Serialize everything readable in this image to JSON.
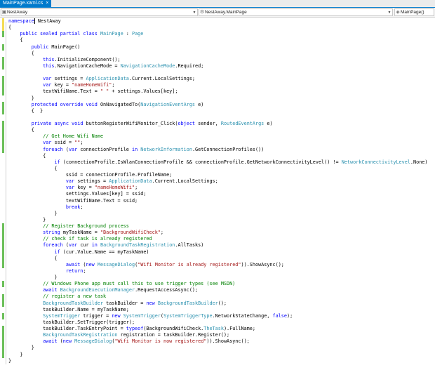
{
  "tab": {
    "label": "MainPage.xaml.cs",
    "close": "×"
  },
  "nav": {
    "project": "NestAway",
    "type": "NestAway.MainPage",
    "member": "MainPage()"
  },
  "code_lines": [
    [
      [
        "k",
        "namespace"
      ],
      [
        "p",
        " NestAway"
      ]
    ],
    [
      [
        "p",
        "{"
      ]
    ],
    [
      [
        "p",
        "    "
      ],
      [
        "k",
        "public sealed partial class"
      ],
      [
        "p",
        " "
      ],
      [
        "t",
        "MainPage"
      ],
      [
        "p",
        " : "
      ],
      [
        "t",
        "Page"
      ]
    ],
    [
      [
        "p",
        "    {"
      ]
    ],
    [
      [
        "p",
        "        "
      ],
      [
        "k",
        "public"
      ],
      [
        "p",
        " MainPage()"
      ]
    ],
    [
      [
        "p",
        "        {"
      ]
    ],
    [
      [
        "p",
        "            "
      ],
      [
        "k",
        "this"
      ],
      [
        "p",
        ".InitializeComponent();"
      ]
    ],
    [
      [
        "p",
        "            "
      ],
      [
        "k",
        "this"
      ],
      [
        "p",
        ".NavigationCacheMode = "
      ],
      [
        "t",
        "NavigationCacheMode"
      ],
      [
        "p",
        ".Required;"
      ]
    ],
    [
      [
        "p",
        ""
      ]
    ],
    [
      [
        "p",
        "            "
      ],
      [
        "k",
        "var"
      ],
      [
        "p",
        " settings = "
      ],
      [
        "t",
        "ApplicationData"
      ],
      [
        "p",
        ".Current.LocalSettings;"
      ]
    ],
    [
      [
        "p",
        "            "
      ],
      [
        "k",
        "var"
      ],
      [
        "p",
        " key = "
      ],
      [
        "s",
        "\"nameHomeWifi\""
      ],
      [
        "p",
        ";"
      ]
    ],
    [
      [
        "p",
        "            textWifiName.Text = "
      ],
      [
        "s",
        "\" \""
      ],
      [
        "p",
        " + settings.Values[key];"
      ]
    ],
    [
      [
        "p",
        "        }"
      ]
    ],
    [
      [
        "p",
        "        "
      ],
      [
        "k",
        "protected override void"
      ],
      [
        "p",
        " OnNavigatedTo("
      ],
      [
        "t",
        "NavigationEventArgs"
      ],
      [
        "p",
        " e)"
      ]
    ],
    [
      [
        "p",
        "        {  }"
      ]
    ],
    [
      [
        "p",
        ""
      ]
    ],
    [
      [
        "p",
        "        "
      ],
      [
        "k",
        "private async void"
      ],
      [
        "p",
        " buttonRegisterWifiMonitor_Click("
      ],
      [
        "k",
        "object"
      ],
      [
        "p",
        " sender, "
      ],
      [
        "t",
        "RoutedEventArgs"
      ],
      [
        "p",
        " e)"
      ]
    ],
    [
      [
        "p",
        "        {"
      ]
    ],
    [
      [
        "p",
        "            "
      ],
      [
        "c",
        "// Get Home Wifi Name"
      ]
    ],
    [
      [
        "p",
        "            "
      ],
      [
        "k",
        "var"
      ],
      [
        "p",
        " ssid = "
      ],
      [
        "s",
        "\"\""
      ],
      [
        "p",
        ";"
      ]
    ],
    [
      [
        "p",
        "            "
      ],
      [
        "k",
        "foreach"
      ],
      [
        "p",
        " ("
      ],
      [
        "k",
        "var"
      ],
      [
        "p",
        " connectionProfile "
      ],
      [
        "k",
        "in"
      ],
      [
        "p",
        " "
      ],
      [
        "t",
        "NetworkInformation"
      ],
      [
        "p",
        ".GetConnectionProfiles())"
      ]
    ],
    [
      [
        "p",
        "            {"
      ]
    ],
    [
      [
        "p",
        "                "
      ],
      [
        "k",
        "if"
      ],
      [
        "p",
        " (connectionProfile.IsWlanConnectionProfile && connectionProfile.GetNetworkConnectivityLevel() != "
      ],
      [
        "t",
        "NetworkConnectivityLevel"
      ],
      [
        "p",
        ".None)"
      ]
    ],
    [
      [
        "p",
        "                {"
      ]
    ],
    [
      [
        "p",
        "                    ssid = connectionProfile.ProfileName;"
      ]
    ],
    [
      [
        "p",
        "                    "
      ],
      [
        "k",
        "var"
      ],
      [
        "p",
        " settings = "
      ],
      [
        "t",
        "ApplicationData"
      ],
      [
        "p",
        ".Current.LocalSettings;"
      ]
    ],
    [
      [
        "p",
        "                    "
      ],
      [
        "k",
        "var"
      ],
      [
        "p",
        " key = "
      ],
      [
        "s",
        "\"nameHomeWifi\""
      ],
      [
        "p",
        ";"
      ]
    ],
    [
      [
        "p",
        "                    settings.Values[key] = ssid;"
      ]
    ],
    [
      [
        "p",
        "                    textWifiName.Text = ssid;"
      ]
    ],
    [
      [
        "p",
        "                    "
      ],
      [
        "k",
        "break"
      ],
      [
        "p",
        ";"
      ]
    ],
    [
      [
        "p",
        "                }"
      ]
    ],
    [
      [
        "p",
        "            }"
      ]
    ],
    [
      [
        "p",
        "            "
      ],
      [
        "c",
        "// Register Background process"
      ]
    ],
    [
      [
        "p",
        "            "
      ],
      [
        "k",
        "string"
      ],
      [
        "p",
        " myTaskName = "
      ],
      [
        "s",
        "\"BackgroundWifiCheck\""
      ],
      [
        "p",
        ";"
      ]
    ],
    [
      [
        "p",
        "            "
      ],
      [
        "c",
        "// check if task is already registered"
      ]
    ],
    [
      [
        "p",
        "            "
      ],
      [
        "k",
        "foreach"
      ],
      [
        "p",
        " ("
      ],
      [
        "k",
        "var"
      ],
      [
        "p",
        " cur "
      ],
      [
        "k",
        "in"
      ],
      [
        "p",
        " "
      ],
      [
        "t",
        "BackgroundTaskRegistration"
      ],
      [
        "p",
        ".AllTasks)"
      ]
    ],
    [
      [
        "p",
        "                "
      ],
      [
        "k",
        "if"
      ],
      [
        "p",
        " (cur.Value.Name == myTaskName)"
      ]
    ],
    [
      [
        "p",
        "                {"
      ]
    ],
    [
      [
        "p",
        "                    "
      ],
      [
        "k",
        "await"
      ],
      [
        "p",
        " ("
      ],
      [
        "k",
        "new"
      ],
      [
        "p",
        " "
      ],
      [
        "t",
        "MessageDialog"
      ],
      [
        "p",
        "("
      ],
      [
        "s",
        "\"Wifi Monitor is already registered\""
      ],
      [
        "p",
        ")).ShowAsync();"
      ]
    ],
    [
      [
        "p",
        "                    "
      ],
      [
        "k",
        "return"
      ],
      [
        "p",
        ";"
      ]
    ],
    [
      [
        "p",
        "                }"
      ]
    ],
    [
      [
        "p",
        "            "
      ],
      [
        "c",
        "// Windows Phone app must call this to use trigger types (see MSDN)"
      ]
    ],
    [
      [
        "p",
        "            "
      ],
      [
        "k",
        "await"
      ],
      [
        "p",
        " "
      ],
      [
        "t",
        "BackgroundExecutionManager"
      ],
      [
        "p",
        ".RequestAccessAsync();"
      ]
    ],
    [
      [
        "p",
        "            "
      ],
      [
        "c",
        "// register a new task"
      ]
    ],
    [
      [
        "p",
        "            "
      ],
      [
        "t",
        "BackgroundTaskBuilder"
      ],
      [
        "p",
        " taskBuilder = "
      ],
      [
        "k",
        "new"
      ],
      [
        "p",
        " "
      ],
      [
        "t",
        "BackgroundTaskBuilder"
      ],
      [
        "p",
        "();"
      ]
    ],
    [
      [
        "p",
        "            taskBuilder.Name = myTaskName;"
      ]
    ],
    [
      [
        "p",
        "            "
      ],
      [
        "t",
        "SystemTrigger"
      ],
      [
        "p",
        " trigger = "
      ],
      [
        "k",
        "new"
      ],
      [
        "p",
        " "
      ],
      [
        "t",
        "SystemTrigger"
      ],
      [
        "p",
        "("
      ],
      [
        "t",
        "SystemTriggerType"
      ],
      [
        "p",
        ".NetworkStateChange, "
      ],
      [
        "k",
        "false"
      ],
      [
        "p",
        ");"
      ]
    ],
    [
      [
        "p",
        "            taskBuilder.SetTrigger(trigger);"
      ]
    ],
    [
      [
        "p",
        "            taskBuilder.TaskEntryPoint = "
      ],
      [
        "k",
        "typeof"
      ],
      [
        "p",
        "(BackgroundWifiCheck."
      ],
      [
        "t",
        "TheTask"
      ],
      [
        "p",
        ").FullName;"
      ]
    ],
    [
      [
        "p",
        "            "
      ],
      [
        "t",
        "BackgroundTaskRegistration"
      ],
      [
        "p",
        " registration = taskBuilder.Register();"
      ]
    ],
    [
      [
        "p",
        "            "
      ],
      [
        "k",
        "await"
      ],
      [
        "p",
        " ("
      ],
      [
        "k",
        "new"
      ],
      [
        "p",
        " "
      ],
      [
        "t",
        "MessageDialog"
      ],
      [
        "p",
        "("
      ],
      [
        "s",
        "\"Wifi Monitor is now registered\""
      ],
      [
        "p",
        ")).ShowAsync();"
      ]
    ],
    [
      [
        "p",
        "        }"
      ]
    ],
    [
      [
        "p",
        "    }"
      ]
    ],
    [
      [
        "p",
        "}"
      ]
    ]
  ],
  "change_markers": [
    [
      "yellow",
      0,
      1
    ],
    [
      "green",
      2,
      2
    ],
    [
      "green",
      4,
      4
    ],
    [
      "green",
      6,
      7
    ],
    [
      "green",
      9,
      11
    ],
    [
      "green",
      13,
      14
    ],
    [
      "green",
      16,
      20
    ],
    [
      "green",
      32,
      38
    ],
    [
      "green",
      41,
      41
    ],
    [
      "green",
      43,
      44
    ],
    [
      "green",
      46,
      46
    ],
    [
      "green",
      48,
      50
    ],
    [
      "green",
      51,
      52
    ]
  ],
  "colors": {
    "keyword": "#0000ff",
    "type": "#2b91af",
    "string": "#a31515",
    "comment": "#008000",
    "accent": "#007acc",
    "change_saved": "#6bbf59",
    "change_unsaved": "#f4dc53"
  }
}
